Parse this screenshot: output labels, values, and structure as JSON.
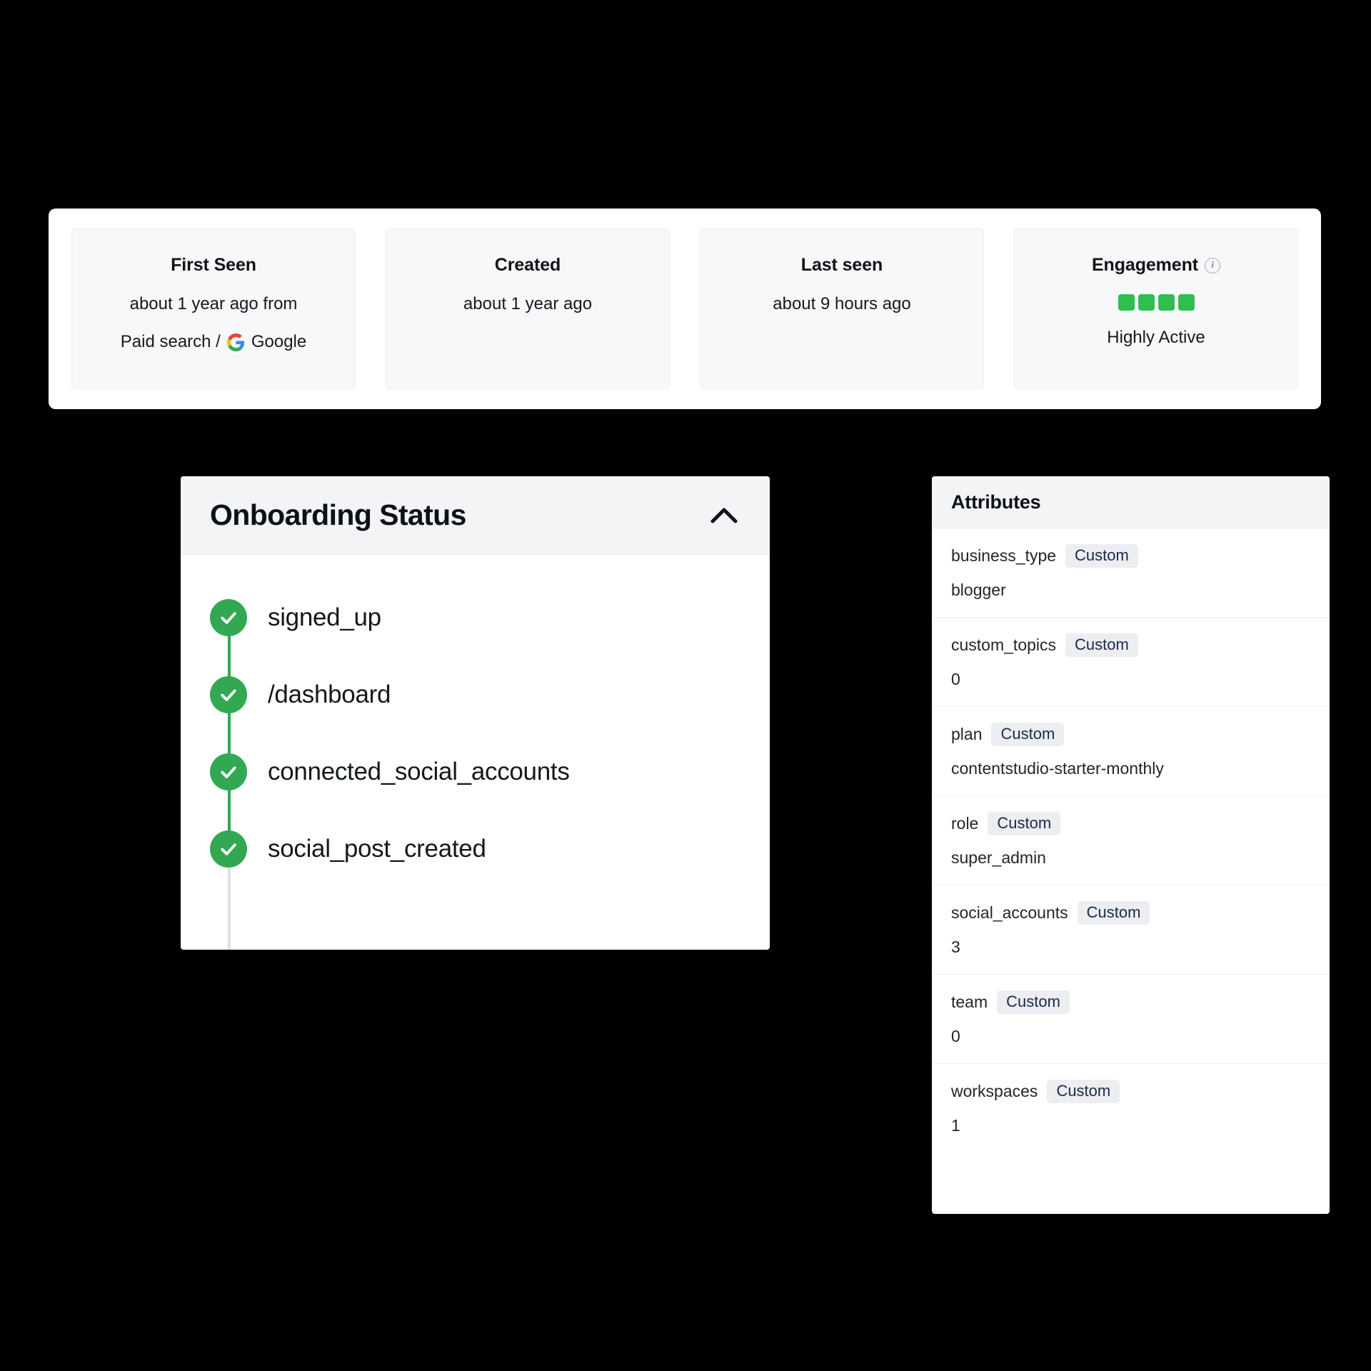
{
  "summary": {
    "tiles": [
      {
        "title": "First Seen",
        "icon": null,
        "line1": "about 1 year ago from",
        "line2_prefix": "Paid search /",
        "line2_brand": "Google",
        "brand_icon": "google-logo-icon"
      },
      {
        "title": "Created",
        "icon": null,
        "line1": "about 1 year ago"
      },
      {
        "title": "Last seen",
        "icon": null,
        "line1": "about 9 hours ago"
      },
      {
        "title": "Engagement",
        "icon": "info-icon",
        "engagement_level": 4,
        "engagement_total": 4,
        "engagement_label": "Highly Active",
        "engagement_color": "#2ebf4f"
      }
    ]
  },
  "onboarding": {
    "title": "Onboarding Status",
    "collapse_icon": "chevron-up-icon",
    "steps": [
      {
        "label": "signed_up",
        "status": "complete"
      },
      {
        "label": "/dashboard",
        "status": "complete"
      },
      {
        "label": "connected_social_accounts",
        "status": "complete"
      },
      {
        "label": "social_post_created",
        "status": "complete"
      }
    ],
    "complete_color": "#32a852",
    "pending_color": "#dcdfe3"
  },
  "attributes": {
    "title": "Attributes",
    "badge_label": "Custom",
    "rows": [
      {
        "key": "business_type",
        "badge": "Custom",
        "value": "blogger"
      },
      {
        "key": "custom_topics",
        "badge": "Custom",
        "value": "0"
      },
      {
        "key": "plan",
        "badge": "Custom",
        "value": "contentstudio-starter-monthly"
      },
      {
        "key": "role",
        "badge": "Custom",
        "value": "super_admin"
      },
      {
        "key": "social_accounts",
        "badge": "Custom",
        "value": "3"
      },
      {
        "key": "team",
        "badge": "Custom",
        "value": "0"
      },
      {
        "key": "workspaces",
        "badge": "Custom",
        "value": "1"
      }
    ]
  }
}
